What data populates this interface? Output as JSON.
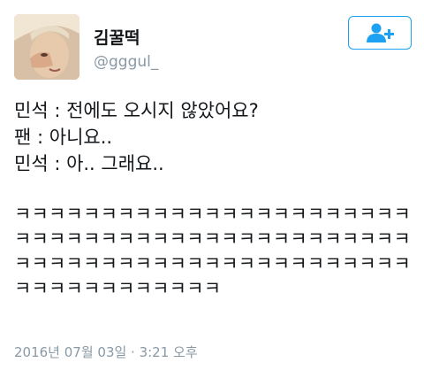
{
  "user": {
    "display_name": "김꿀떡",
    "handle": "@gggul_"
  },
  "follow_button": {
    "icon": "add-user-icon",
    "color": "#1da1f2"
  },
  "tweet": {
    "lines": [
      "민석 : 전에도 오시지 않았어요?",
      "팬 : 아니요..",
      "민석 : 아.. 그래요.."
    ],
    "laugh": "ㅋㅋㅋㅋㅋㅋㅋㅋㅋㅋㅋㅋㅋㅋㅋㅋㅋㅋㅋㅋㅋㅋㅋㅋㅋㅋㅋㅋㅋㅋㅋㅋㅋㅋㅋㅋㅋㅋㅋㅋㅋㅋㅋㅋㅋㅋㅋㅋㅋㅋㅋㅋㅋㅋㅋㅋㅋㅋㅋㅋㅋㅋㅋㅋㅋㅋㅋㅋㅋㅋㅋㅋㅋㅋㅋㅋㅋㅋㅋㅋㅋ",
    "timestamp": "2016년 07월 03일 · 3:21 오후"
  }
}
